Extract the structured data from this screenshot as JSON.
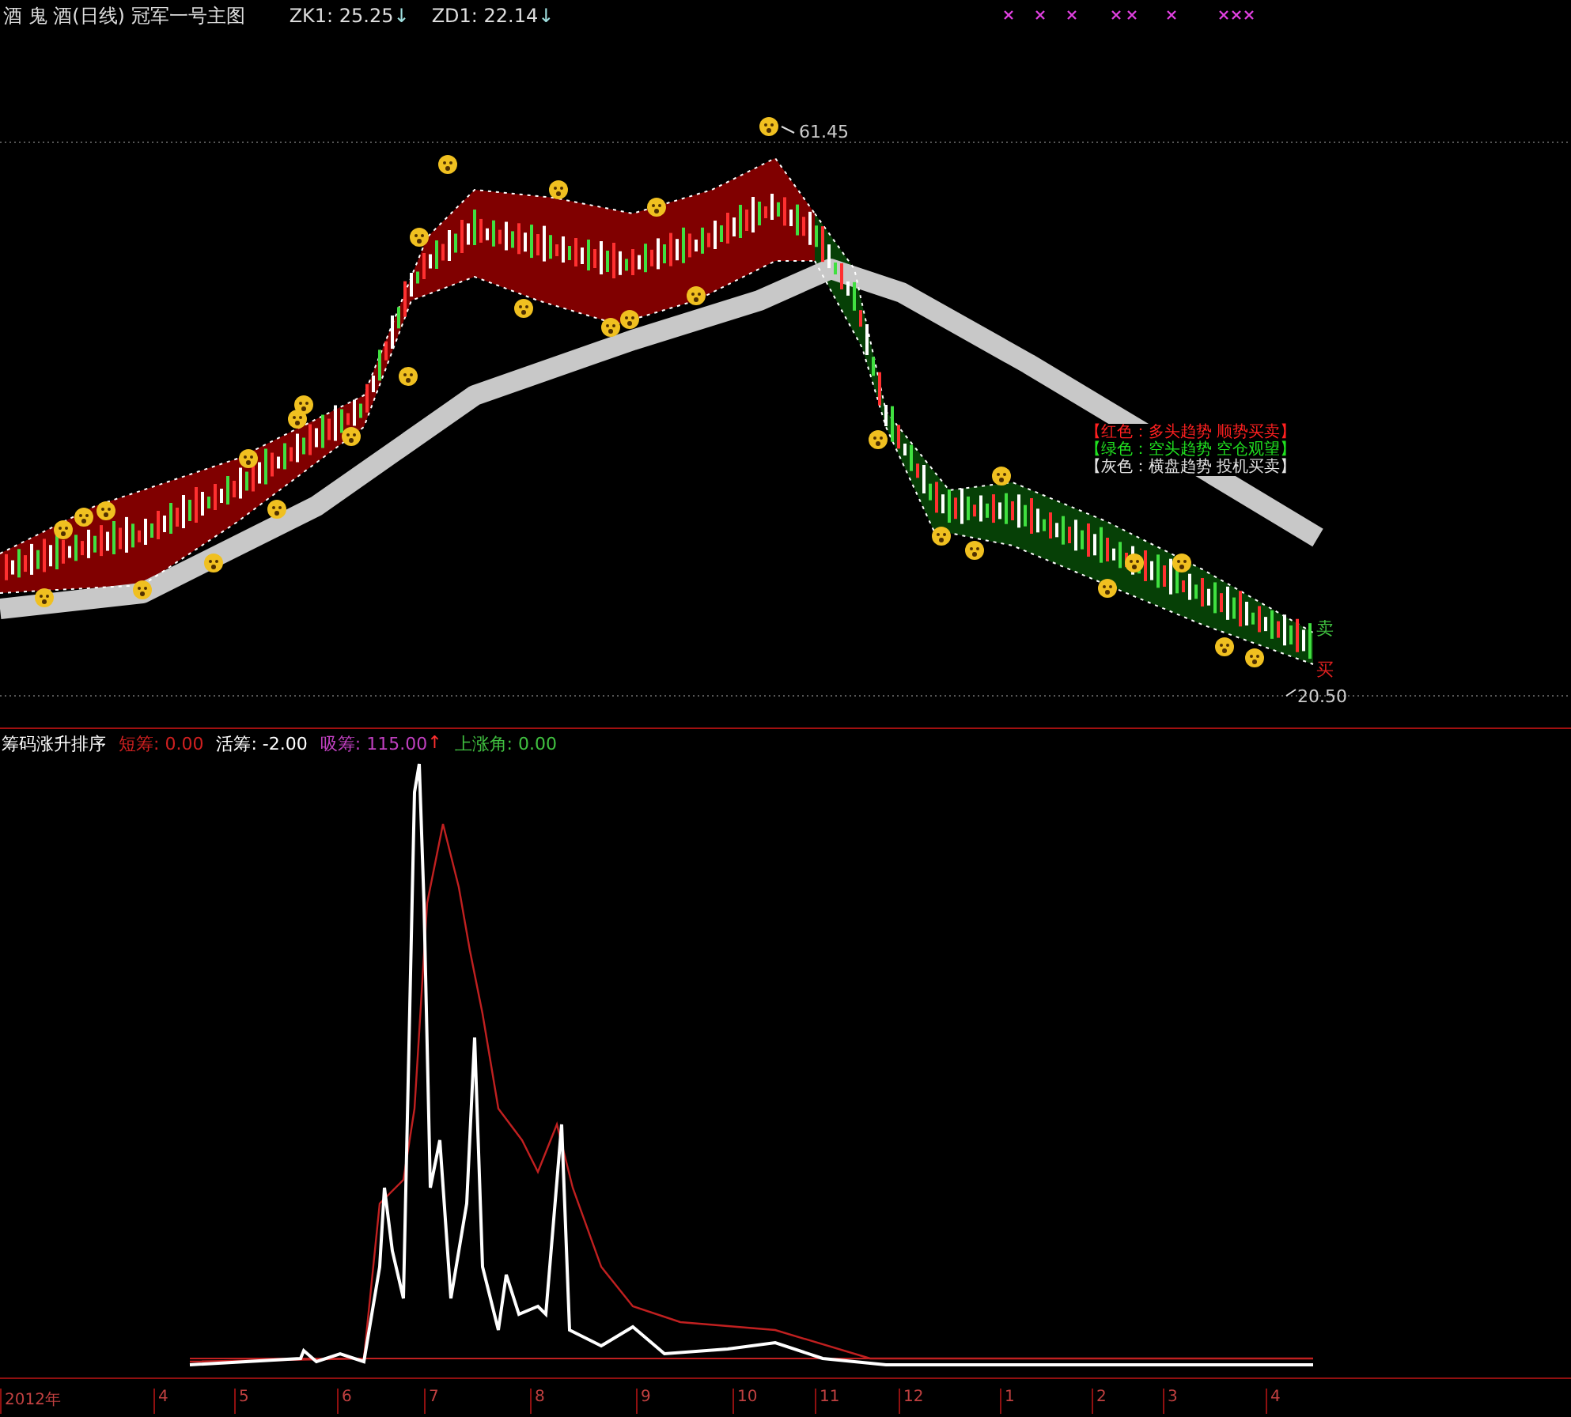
{
  "header": {
    "title": "酒 鬼 酒(日线) 冠军一号主图",
    "indicators": [
      {
        "label": "ZK1:",
        "value": "25.25",
        "arrow": "↓"
      },
      {
        "label": "ZD1:",
        "value": "22.14",
        "arrow": "↓"
      }
    ]
  },
  "price_chart": {
    "high_label": "61.45",
    "low_label": "20.50",
    "signals": [
      {
        "text": "卖",
        "kind": "sell"
      },
      {
        "text": "买",
        "kind": "buy"
      }
    ],
    "legend": [
      {
        "text": "【红色：多头趋势 顺势买卖】",
        "color": "#ff2020"
      },
      {
        "text": "【绿色：空头趋势 空仓观望】",
        "color": "#20e020"
      },
      {
        "text": "【灰色：横盘趋势 投机买卖】",
        "color": "#e0e0e0"
      }
    ]
  },
  "indicator_panel": {
    "title": "筹码涨升排序",
    "values": [
      {
        "label": "短筹:",
        "value": "0.00",
        "color": "#d02020"
      },
      {
        "label": "活筹:",
        "value": "-2.00",
        "color": "#ffffff"
      },
      {
        "label": "吸筹:",
        "value": "115.00",
        "color": "#c040c0",
        "arrow": "↑"
      },
      {
        "label": "上涨角:",
        "value": "0.00",
        "color": "#40c040"
      }
    ]
  },
  "time_axis": {
    "labels": [
      "2012年",
      "4",
      "5",
      "6",
      "7",
      "8",
      "9",
      "10",
      "11",
      "12",
      "1",
      "2",
      "3",
      "4"
    ]
  }
}
